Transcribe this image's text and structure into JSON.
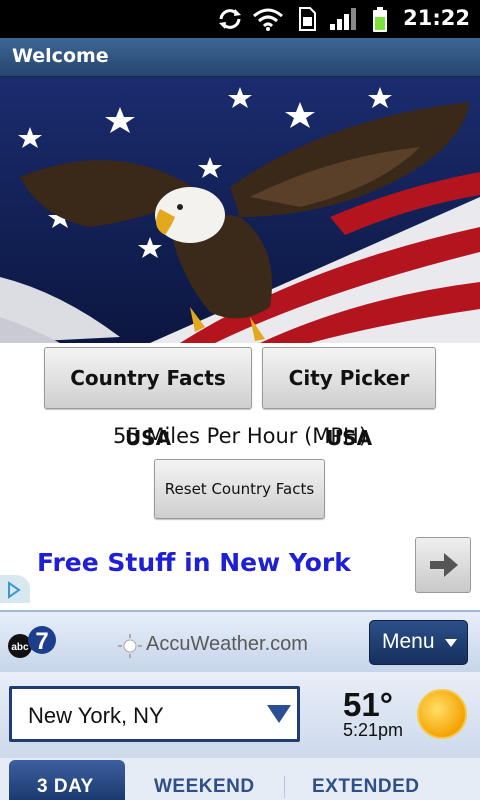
{
  "status_bar": {
    "time": "21:22",
    "icons": [
      "sync-icon",
      "wifi-icon",
      "sim-icon",
      "signal-icon",
      "battery-icon"
    ],
    "battery_color": "#7ee03a"
  },
  "header": {
    "title": "Welcome"
  },
  "banner": {
    "image": "bald-eagle-american-flag"
  },
  "actions": {
    "country_facts_label": "Country Facts USA",
    "city_picker_label": "City Picker USA",
    "fact_text": "55 Miles Per Hour (MPH)",
    "reset_label": "Reset Country Facts"
  },
  "ad": {
    "text": "Free Stuff in New York",
    "text_color": "#1f1fd6"
  },
  "weather": {
    "brand": "AccuWeather.com",
    "menu_label": "Menu",
    "location": "New York, NY",
    "temperature": "51°",
    "time": "5:21pm",
    "tabs": [
      {
        "label": "3 DAY",
        "active": true
      },
      {
        "label": "WEEKEND",
        "active": false
      },
      {
        "label": "EXTENDED",
        "active": false
      }
    ],
    "accent_color": "#1f3d72"
  }
}
